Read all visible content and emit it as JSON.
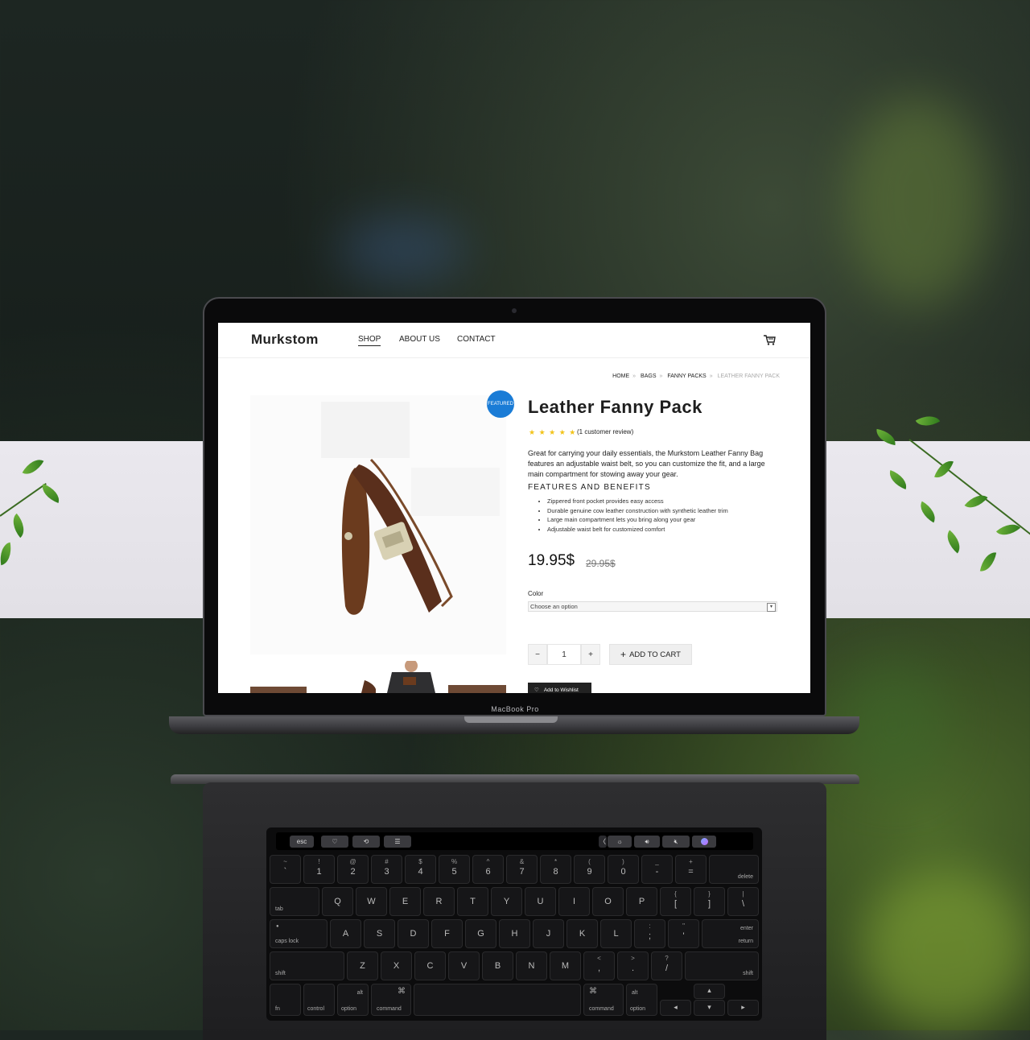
{
  "site": {
    "logo": "Murkstom",
    "nav": [
      "SHOP",
      "ABOUT US",
      "CONTACT"
    ],
    "active_nav": "SHOP"
  },
  "breadcrumb": [
    "HOME",
    "BAGS",
    "FANNY PACKS",
    "LEATHER FANNY PACK"
  ],
  "product": {
    "badge": "FEATURED",
    "title": "Leather Fanny Pack",
    "rating_stars": "★ ★ ★ ★ ★",
    "rating_value": 5,
    "review_text": "(1 customer review)",
    "description": "Great for carrying your daily essentials, the Murkstom Leather Fanny Bag features an adjustable waist belt, so you can customize the fit, and a large main compartment for stowing away your gear.",
    "features_heading": "FEATURES AND BENEFITS",
    "features": [
      "Zippered front pocket provides easy access",
      "Durable genuine cow leather construction with synthetic leather trim",
      "Large main compartment lets you bring along your gear",
      "Adjustable waist belt for customized comfort"
    ],
    "price": "19.95$",
    "old_price": "29.95$",
    "color_label": "Color",
    "color_placeholder": "Choose an option",
    "qty_minus": "−",
    "qty_value": "1",
    "qty_plus": "+",
    "add_to_cart_icon": "+",
    "add_to_cart": "ADD TO CART",
    "wishlist": "Add to Wishlist",
    "accent_color": "#1a7cd6",
    "star_color": "#f2c31a"
  },
  "device": {
    "brand_label": "MacBook Pro",
    "touchbar": {
      "esc": "esc",
      "left_icons": [
        "heart-icon",
        "rotate-icon",
        "sliders-icon"
      ],
      "chevron": "〈",
      "brightness": "☼",
      "volume": "🔊︎",
      "mute": "🔇︎",
      "siri": "siri-icon"
    },
    "keyboard": {
      "row1": [
        [
          "~",
          "`"
        ],
        [
          "!",
          "1"
        ],
        [
          "@",
          "2"
        ],
        [
          "#",
          "3"
        ],
        [
          "$",
          "4"
        ],
        [
          "%",
          "5"
        ],
        [
          "^",
          "6"
        ],
        [
          "&",
          "7"
        ],
        [
          "*",
          "8"
        ],
        [
          "(",
          "9"
        ],
        [
          ")",
          "0"
        ],
        [
          "_",
          "-"
        ],
        [
          "+",
          "="
        ]
      ],
      "delete": "delete",
      "tab": "tab",
      "row2": [
        "Q",
        "W",
        "E",
        "R",
        "T",
        "Y",
        "U",
        "I",
        "O",
        "P"
      ],
      "row2_extra": [
        [
          "{",
          "["
        ],
        [
          "}",
          "]"
        ],
        [
          "|",
          "\\"
        ]
      ],
      "caps": "caps lock",
      "row3": [
        "A",
        "S",
        "D",
        "F",
        "G",
        "H",
        "J",
        "K",
        "L"
      ],
      "row3_extra": [
        [
          ":",
          ";"
        ],
        [
          "\"",
          "'"
        ]
      ],
      "enter_top": "enter",
      "enter": "return",
      "shift": "shift",
      "row4": [
        "Z",
        "X",
        "C",
        "V",
        "B",
        "N",
        "M"
      ],
      "row4_extra": [
        [
          "<",
          ","
        ],
        [
          ">",
          "."
        ],
        [
          "?",
          "/"
        ]
      ],
      "shift_r": "shift",
      "fn": "fn",
      "control": "control",
      "option": "option",
      "option_sym": "alt",
      "command": "command",
      "command_sym": "⌘",
      "command_r": "command",
      "option_r": "option",
      "arrow_left": "◂",
      "arrow_up": "▴",
      "arrow_down": "▾",
      "arrow_right": "▸"
    }
  }
}
